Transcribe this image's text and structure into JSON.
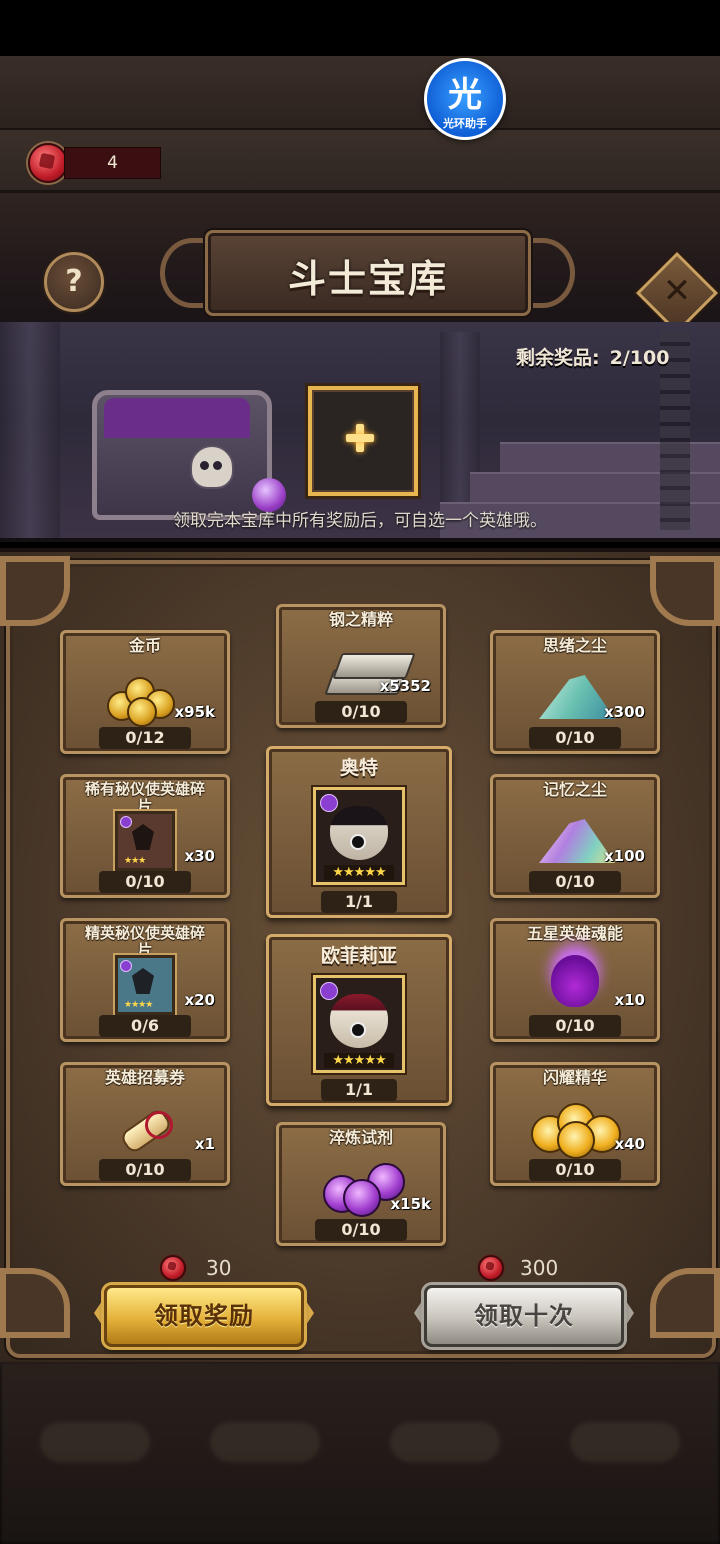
{
  "currency": {
    "tickets": "4"
  },
  "assistant": {
    "glyph": "光",
    "label": "光环助手"
  },
  "header": {
    "title": "斗士宝库",
    "help_glyph": "?",
    "close_glyph": "✕"
  },
  "vault": {
    "remaining_label": "剩余奖品:",
    "remaining_value": "2/100",
    "hint": "领取完本宝库中所有奖励后，可自选一个英雄哦。"
  },
  "rewards": {
    "gold": {
      "name": "金币",
      "qty": "x95k",
      "count": "0/12"
    },
    "steel": {
      "name": "钢之精粹",
      "qty": "x5352",
      "count": "0/10"
    },
    "thought_dust": {
      "name": "思绪之尘",
      "qty": "x300",
      "count": "0/10"
    },
    "rare_shard": {
      "name": "稀有秘仪使英雄碎片",
      "qty": "x30",
      "count": "0/10",
      "stars": "★★★"
    },
    "memory_dust": {
      "name": "记忆之尘",
      "qty": "x100",
      "count": "0/10"
    },
    "elite_shard": {
      "name": "精英秘仪使英雄碎片",
      "qty": "x20",
      "count": "0/6",
      "stars": "★★★★"
    },
    "five_star_soul": {
      "name": "五星英雄魂能",
      "qty": "x10",
      "count": "0/10"
    },
    "recruit_ticket": {
      "name": "英雄招募券",
      "qty": "x1",
      "count": "0/10"
    },
    "shining_essence": {
      "name": "闪耀精华",
      "qty": "x40",
      "count": "0/10"
    },
    "tempering_potion": {
      "name": "淬炼试剂",
      "qty": "x15k",
      "count": "0/10"
    }
  },
  "heroes": [
    {
      "name": "奥特",
      "count": "1/1",
      "stars": "★★★★★"
    },
    {
      "name": "欧菲莉亚",
      "count": "1/1",
      "stars": "★★★★★"
    }
  ],
  "actions": {
    "claim": {
      "cost": "30",
      "label": "领取奖励"
    },
    "claim10": {
      "cost": "300",
      "label": "领取十次"
    }
  },
  "colors": {
    "gold_button": "#e5b23a",
    "silver_button": "#c8c4bc",
    "gem": "#c01c28",
    "frame": "#b89462"
  }
}
